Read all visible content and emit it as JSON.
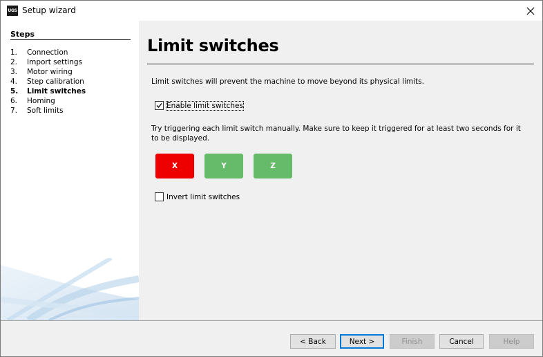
{
  "window": {
    "title": "Setup wizard",
    "app_icon_text": "UGS"
  },
  "sidebar": {
    "title": "Steps",
    "steps": [
      {
        "num": "1.",
        "label": "Connection"
      },
      {
        "num": "2.",
        "label": "Import settings"
      },
      {
        "num": "3.",
        "label": "Motor wiring"
      },
      {
        "num": "4.",
        "label": "Step calibration"
      },
      {
        "num": "5.",
        "label": "Limit switches"
      },
      {
        "num": "6.",
        "label": "Homing"
      },
      {
        "num": "7.",
        "label": "Soft limits"
      }
    ],
    "current_step": 5
  },
  "main": {
    "title": "Limit switches",
    "description": "Limit switches will prevent the machine to move beyond its physical limits.",
    "enable_checkbox": {
      "label": "Enable limit switches",
      "checked": true
    },
    "trigger_text": "Try triggering each limit switch manually. Make sure to keep it triggered for at least two seconds for it to be displayed.",
    "switches": [
      {
        "label": "X",
        "state": "triggered",
        "color": "#ee0000"
      },
      {
        "label": "Y",
        "state": "idle",
        "color": "#66bb6a"
      },
      {
        "label": "Z",
        "state": "idle",
        "color": "#66bb6a"
      }
    ],
    "invert_checkbox": {
      "label": "Invert limit switches",
      "checked": false
    }
  },
  "footer": {
    "back_label": "< Back",
    "next_label": "Next >",
    "finish_label": "Finish",
    "cancel_label": "Cancel",
    "help_label": "Help"
  }
}
